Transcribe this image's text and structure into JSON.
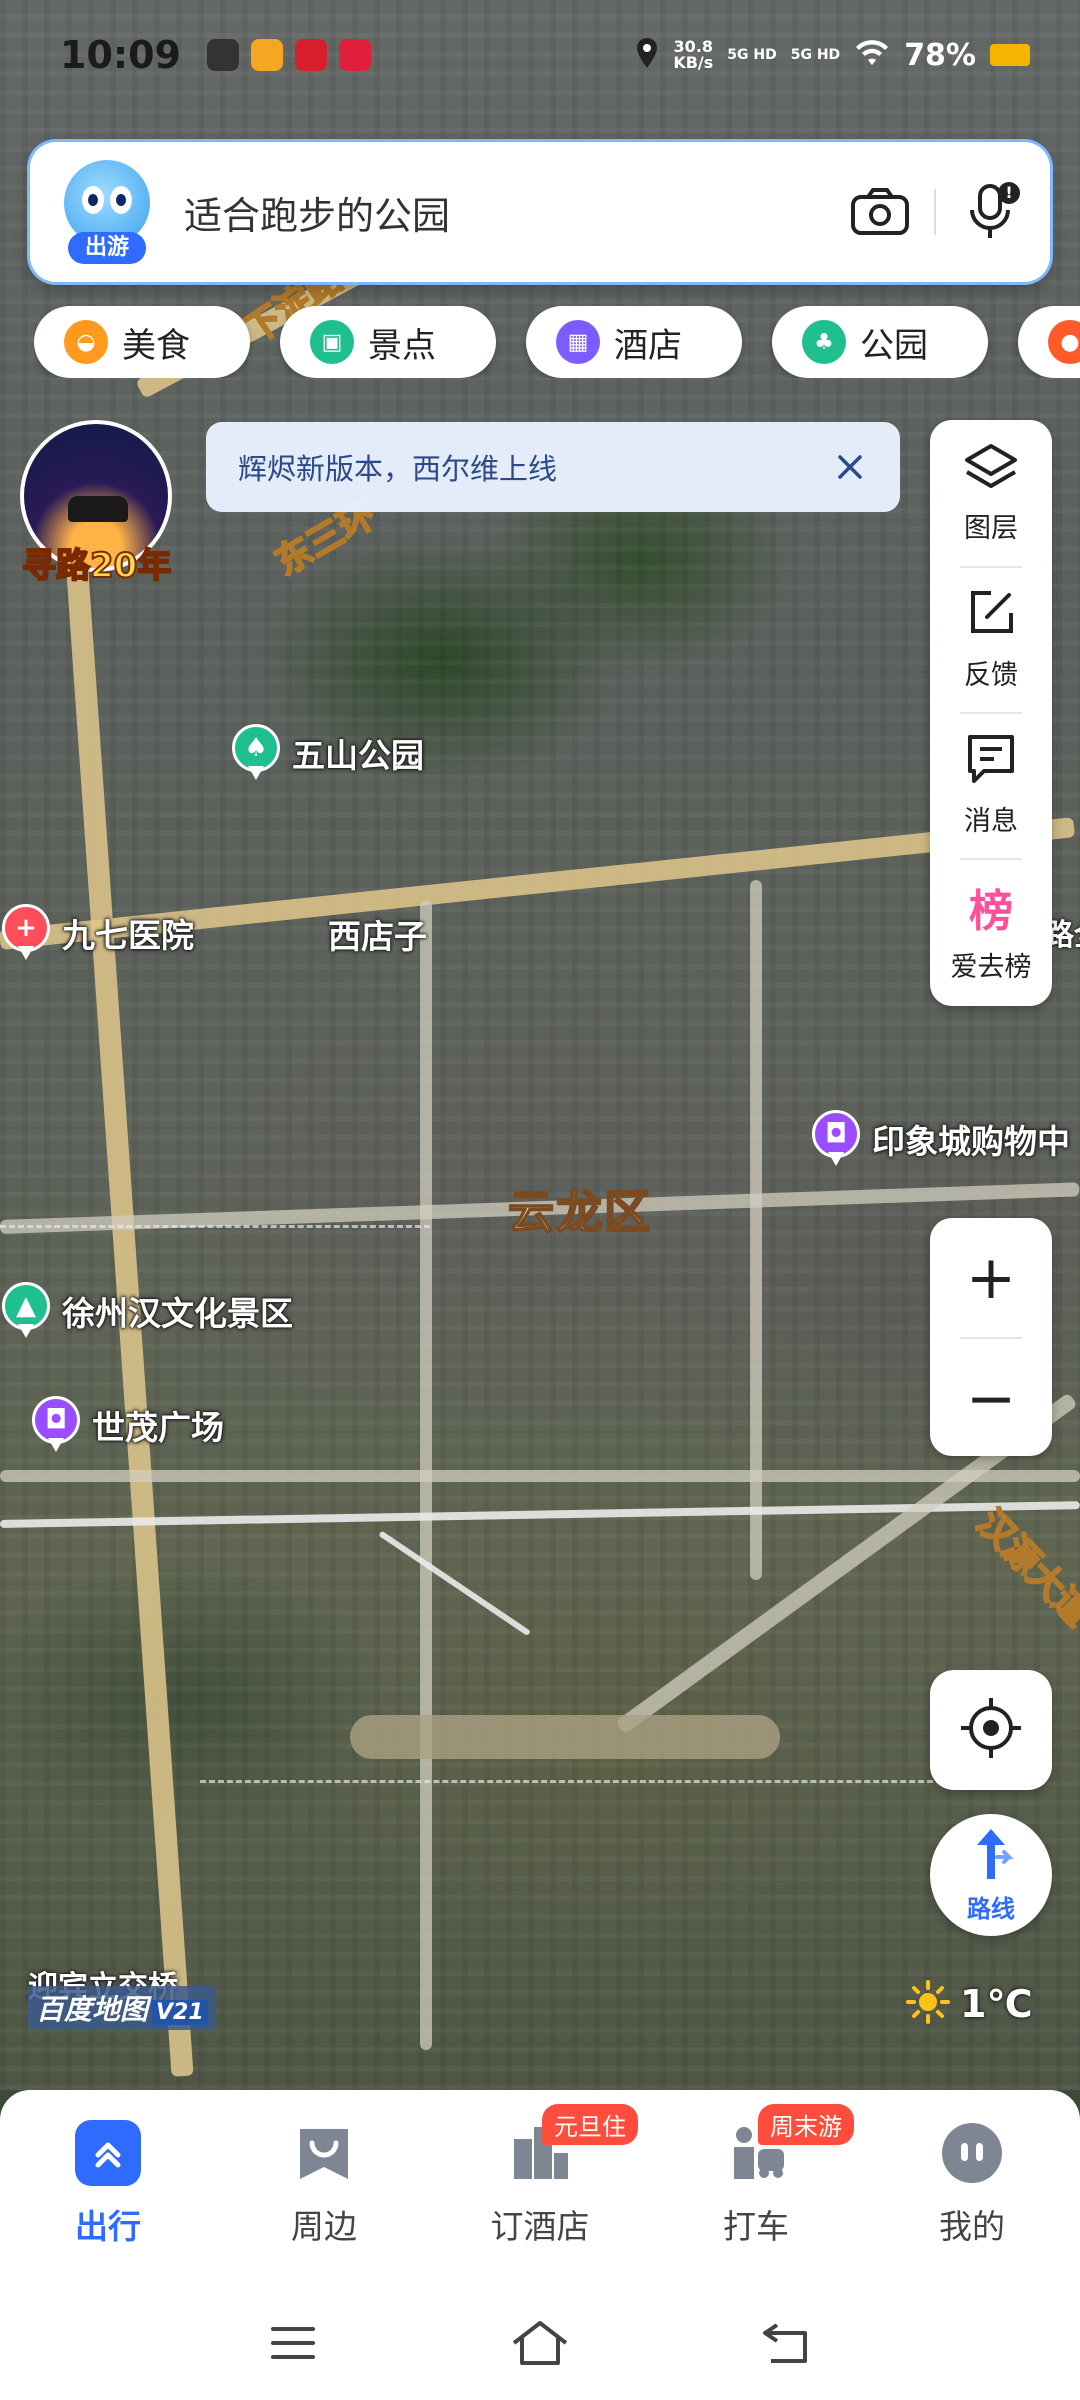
{
  "status_bar": {
    "time": "10:09",
    "net_speed": "30.8",
    "net_unit": "KB/s",
    "signal1": "5G HD",
    "signal2": "5G HD",
    "battery": "78%"
  },
  "search": {
    "mascot_tag": "出游",
    "query": "适合跑步的公园"
  },
  "chips": [
    {
      "label": "美食",
      "color": "#ff9a1f"
    },
    {
      "label": "景点",
      "color": "#1fbf8f"
    },
    {
      "label": "酒店",
      "color": "#7b5cff"
    },
    {
      "label": "公园",
      "color": "#1fbf8f"
    }
  ],
  "promo": {
    "label": "寻路20年"
  },
  "notice": {
    "text": "辉烬新版本，西尔维上线"
  },
  "tools": {
    "layers": "图层",
    "feedback": "反馈",
    "messages": "消息",
    "ranking": "爱去榜",
    "ranking_glyph": "榜"
  },
  "zoom": {
    "in": "+",
    "out": "−"
  },
  "route": {
    "label": "路线"
  },
  "map": {
    "district": "云龙区",
    "roads": [
      "东三环",
      "下淀路",
      "汉源大道"
    ],
    "labels": {
      "xidianzi": "西店子",
      "bridge": "迎宾立交桥",
      "edge_text": "路全"
    },
    "pois": [
      {
        "name": "五山公园",
        "type": "park"
      },
      {
        "name": "九七医院",
        "type": "hospital"
      },
      {
        "name": "印象城购物中",
        "type": "shopping"
      },
      {
        "name": "徐州汉文化景区",
        "type": "scenic"
      },
      {
        "name": "世茂广场",
        "type": "shopping"
      }
    ]
  },
  "logo": {
    "text": "百度地图",
    "version": "V21"
  },
  "weather": {
    "temp": "1℃",
    "icon": "sun-icon"
  },
  "bottom_nav": [
    {
      "label": "出行",
      "active": true
    },
    {
      "label": "周边",
      "active": false
    },
    {
      "label": "订酒店",
      "badge": "元旦住",
      "active": false
    },
    {
      "label": "打车",
      "badge": "周末游",
      "active": false
    },
    {
      "label": "我的",
      "active": false
    }
  ],
  "colors": {
    "accent": "#2f6bff",
    "park": "#1fbf8f",
    "hospital": "#ff4d5a",
    "shopping": "#9a4dff",
    "badge": "#ff4d3d"
  }
}
